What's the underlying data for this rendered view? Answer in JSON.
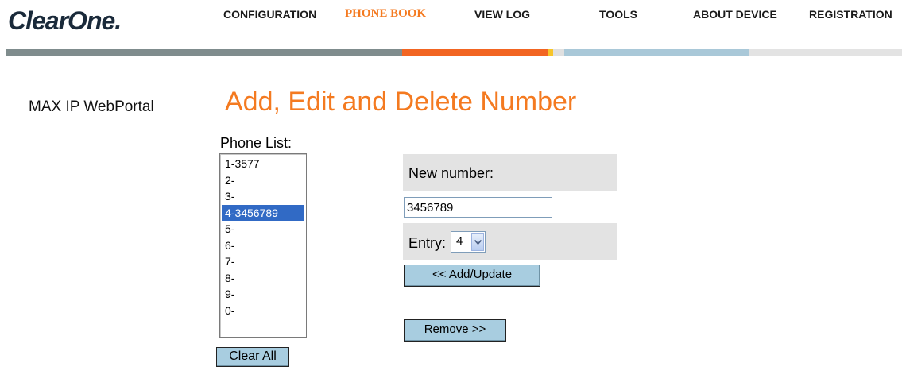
{
  "brand": {
    "logo_text": "ClearOne."
  },
  "nav": {
    "items": [
      {
        "label": "CONFIGURATION",
        "active": false
      },
      {
        "label": "PHONE BOOK",
        "active": true
      },
      {
        "label": "VIEW LOG",
        "active": false
      },
      {
        "label": "TOOLS",
        "active": false
      },
      {
        "label": "ABOUT DEVICE",
        "active": false
      },
      {
        "label": "REGISTRATION",
        "active": false
      }
    ]
  },
  "colors": {
    "accent": "#f47a20",
    "bar_gray": "#7f8c8d",
    "bar_blue": "#a9c8d8",
    "bar_yellow": "#f7c52a",
    "button": "#a8cde0"
  },
  "sidebar": {
    "portal_label": "MAX IP WebPortal"
  },
  "main": {
    "title": "Add, Edit and Delete Number",
    "phone_list_label": "Phone List:",
    "phone_list": [
      "1-3577",
      "2-",
      "3-",
      "4-3456789",
      "5-",
      "6-",
      "7-",
      "8-",
      "9-",
      "0-"
    ],
    "selected_index": 3,
    "clear_all_label": "Clear All",
    "new_number_label": "New number:",
    "new_number_value": "3456789",
    "entry_label": "Entry:",
    "entry_value": "4",
    "add_update_label": "<< Add/Update",
    "remove_label": "Remove >>"
  }
}
